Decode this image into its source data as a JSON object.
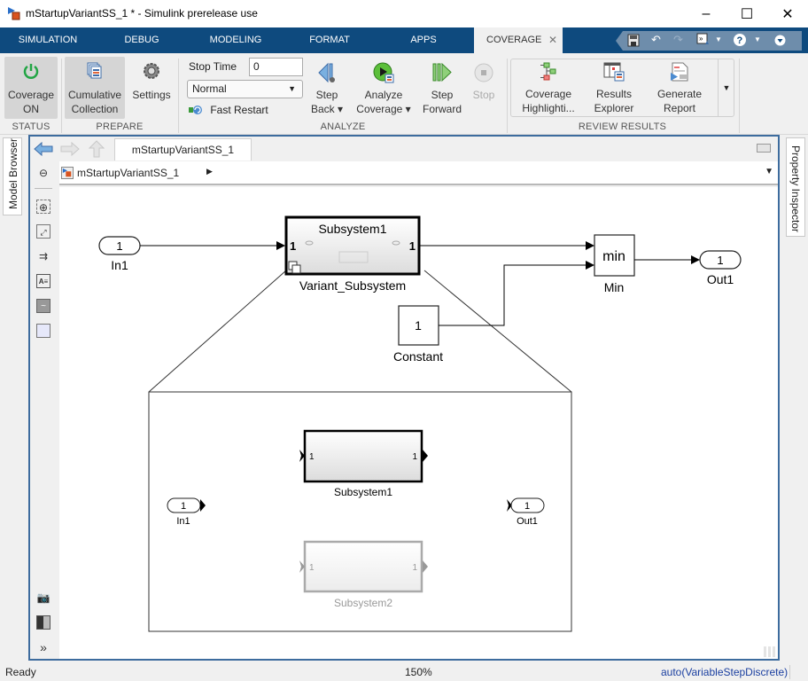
{
  "window": {
    "title": "mStartupVariantSS_1 * - Simulink prerelease use",
    "minimize": "–",
    "maximize": "☐",
    "close": "✕"
  },
  "tabs": [
    {
      "label": "SIMULATION"
    },
    {
      "label": "DEBUG"
    },
    {
      "label": "MODELING"
    },
    {
      "label": "FORMAT"
    },
    {
      "label": "APPS"
    },
    {
      "label": "COVERAGE",
      "active": true,
      "close": "✕"
    }
  ],
  "quick_access": {
    "icons": [
      "save-icon",
      "undo-icon",
      "redo-icon",
      "shortcut-icon",
      "help-icon",
      "expand-icon"
    ]
  },
  "ribbon": {
    "status": {
      "section_label": "STATUS",
      "coverage_button": {
        "line1": "Coverage",
        "line2": "ON"
      }
    },
    "prepare": {
      "section_label": "PREPARE",
      "cumulative_button": {
        "line1": "Cumulative",
        "line2": "Collection"
      },
      "settings_button": {
        "label": "Settings"
      }
    },
    "analyze": {
      "section_label": "ANALYZE",
      "stop_time_label": "Stop Time",
      "stop_time_value": "0",
      "mode_value": "Normal",
      "fast_restart_label": "Fast Restart",
      "step_back": {
        "line1": "Step",
        "line2": "Back ▾"
      },
      "analyze_coverage": {
        "line1": "Analyze",
        "line2": "Coverage ▾"
      },
      "step_forward": {
        "line1": "Step",
        "line2": "Forward"
      },
      "stop": {
        "label": "Stop"
      }
    },
    "review": {
      "section_label": "REVIEW RESULTS",
      "coverage_highlighting": {
        "line1": "Coverage",
        "line2": "Highlighti..."
      },
      "results_explorer": {
        "line1": "Results",
        "line2": "Explorer"
      },
      "generate_report": {
        "line1": "Generate",
        "line2": "Report"
      }
    }
  },
  "side_panels": {
    "left": "Model Browser",
    "right": "Property Inspector"
  },
  "editor": {
    "model_tab": "mStartupVariantSS_1",
    "breadcrumb": "mStartupVariantSS_1"
  },
  "diagram": {
    "in1": {
      "port": "1",
      "label": "In1"
    },
    "variant_subsystem": {
      "inner_title": "Subsystem1",
      "in_port": "1",
      "out_port": "1",
      "label": "Variant_Subsystem"
    },
    "min": {
      "text": "min",
      "label": "Min"
    },
    "out1": {
      "port": "1",
      "label": "Out1"
    },
    "constant": {
      "value": "1",
      "label": "Constant"
    },
    "preview": {
      "in1": {
        "port": "1",
        "label": "In1"
      },
      "out1": {
        "port": "1",
        "label": "Out1"
      },
      "subsystem1": {
        "in_port": "1",
        "out_port": "1",
        "label": "Subsystem1"
      },
      "subsystem2": {
        "in_port": "1",
        "out_port": "1",
        "label": "Subsystem2"
      }
    }
  },
  "statusbar": {
    "state": "Ready",
    "zoom": "150%",
    "solver": "auto(VariableStepDiscrete)"
  }
}
